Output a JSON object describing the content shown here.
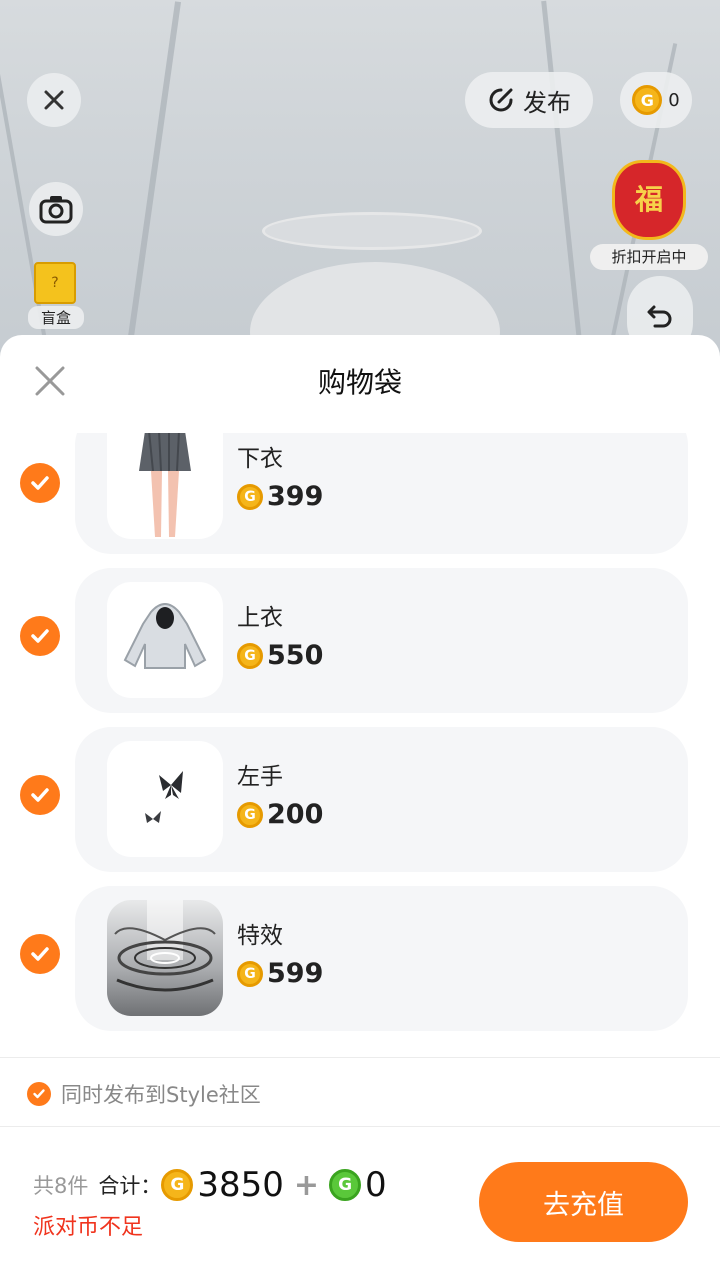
{
  "top_bar": {
    "publish_label": "发布",
    "coin_balance": "0",
    "blindbox_label": "盲盒",
    "promo_label": "折扣开启中",
    "promo_char": "福"
  },
  "sheet": {
    "title": "购物袋",
    "items": [
      {
        "name": "下衣",
        "price": "399",
        "checked": true
      },
      {
        "name": "上衣",
        "price": "550",
        "checked": true
      },
      {
        "name": "左手",
        "price": "200",
        "checked": true
      },
      {
        "name": "特效",
        "price": "599",
        "checked": true
      }
    ],
    "publish_option": "同时发布到Style社区",
    "footer": {
      "count_label": "共8件",
      "total_label": "合计：",
      "gold_amount": "3850",
      "plus": "+",
      "green_amount": "0",
      "warning": "派对币不足",
      "recharge_button": "去充值"
    }
  },
  "colors": {
    "accent": "#ff7a1a",
    "warning": "#f0341e",
    "gold_coin": "#f5b51a",
    "green_coin": "#5ac83a"
  }
}
